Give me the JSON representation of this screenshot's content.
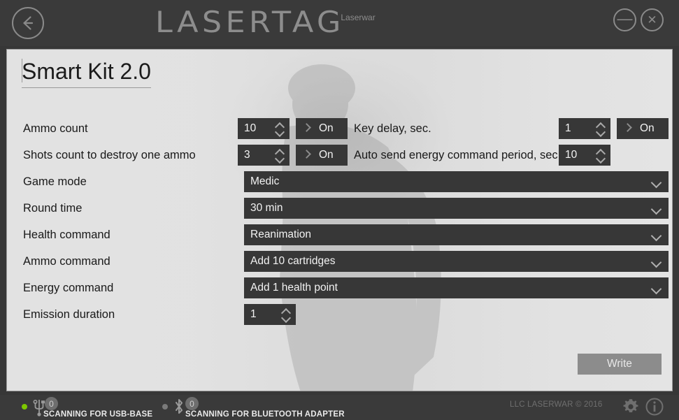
{
  "titlebar": {
    "back_icon": "arrow-left-icon",
    "logo_text": "LASERTAG",
    "logo_sub": "Laserwar",
    "minimize_glyph": "—",
    "close_glyph": "✕"
  },
  "page": {
    "title": "Smart Kit 2.0"
  },
  "form": {
    "left_rows": [
      {
        "label": "Ammo count",
        "value": "10",
        "toggle": "On"
      },
      {
        "label": "Shots count to destroy one ammo",
        "value": "3",
        "toggle": "On"
      }
    ],
    "right_rows": [
      {
        "label": "Key delay, sec.",
        "value": "1",
        "toggle": "On"
      },
      {
        "label": "Auto send energy command period, sec.",
        "value": "10",
        "toggle": null
      }
    ],
    "dropdown_rows": [
      {
        "label": "Game mode",
        "value": "Medic"
      },
      {
        "label": "Round time",
        "value": "30 min"
      },
      {
        "label": "Health command",
        "value": "Reanimation"
      },
      {
        "label": "Ammo command",
        "value": "Add 10 cartridges"
      },
      {
        "label": "Energy command",
        "value": "Add 1 health point"
      }
    ],
    "emission_row": {
      "label": "Emission duration",
      "value": "1"
    },
    "write_button": "Write"
  },
  "statusbar": {
    "usb": {
      "state_color": "#7ec800",
      "icon": "usb-icon",
      "count": "0",
      "text": "SCANNING FOR USB-BASE"
    },
    "bluetooth": {
      "state_color": "#7a7a7a",
      "icon": "bluetooth-icon",
      "count": "0",
      "text": "SCANNING FOR BLUETOOTH ADAPTER"
    },
    "copyright": "LLC LASERWAR © 2016",
    "gear_icon": "gear-icon",
    "info_icon": "info-icon"
  },
  "colors": {
    "field_dark": "#373737",
    "panel_light": "#e3e3e3",
    "accent_green": "#7ec800",
    "chrome": "#3a3a3a"
  }
}
